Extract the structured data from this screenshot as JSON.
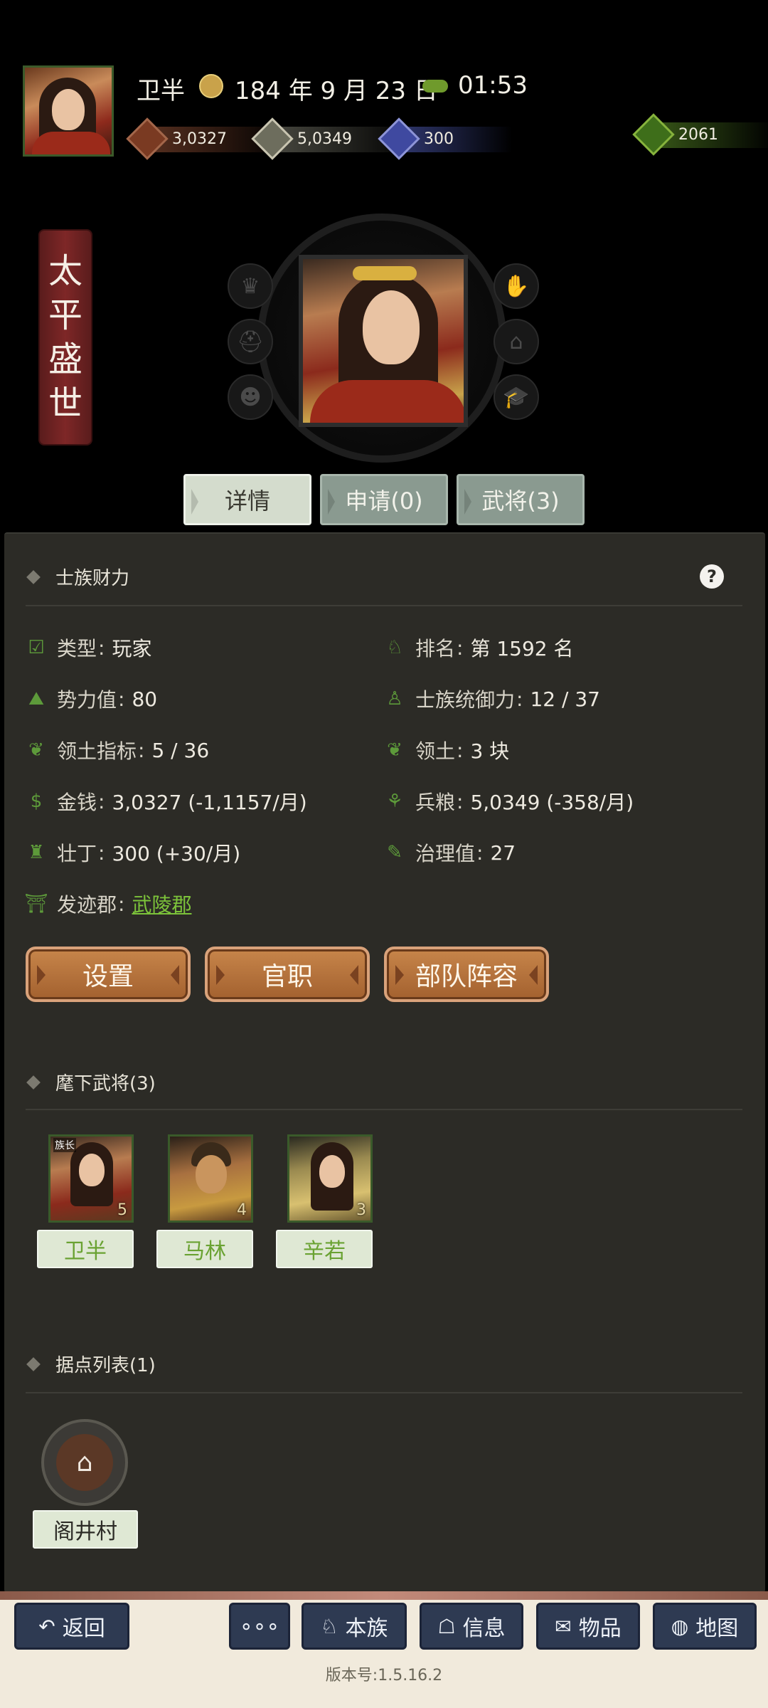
{
  "header": {
    "player_name": "卫半",
    "date": "184 年 9 月 23 日",
    "time": "01:53",
    "resources": {
      "gold": "3,0327",
      "grain": "5,0349",
      "manpower": "300",
      "gourd": "2061"
    }
  },
  "banner": {
    "chars": [
      "太",
      "平",
      "盛",
      "世"
    ]
  },
  "tabs": {
    "details": "详情",
    "apply": "申请(0)",
    "generals": "武将(3)"
  },
  "clan_finance": {
    "title": "士族财力",
    "help_icon": "?",
    "stats": {
      "type": {
        "label": "类型",
        "value": "玩家"
      },
      "rank": {
        "label": "排名",
        "value": "第 1592 名"
      },
      "power": {
        "label": "势力值",
        "value": "80"
      },
      "command": {
        "label": "士族统御力",
        "value": "12 / 37"
      },
      "territory_quota": {
        "label": "领土指标",
        "value": "5 / 36"
      },
      "territory": {
        "label": "领土",
        "value": "3 块"
      },
      "money": {
        "label": "金钱",
        "value": "3,0327 (-1,1157/月)"
      },
      "grain": {
        "label": "兵粮",
        "value": "5,0349 (-358/月)"
      },
      "manpower": {
        "label": "壮丁",
        "value": "300 (+30/月)"
      },
      "governance": {
        "label": "治理值",
        "value": "27"
      },
      "origin": {
        "label": "发迹郡",
        "value": "武陵郡"
      }
    },
    "buttons": {
      "settings": "设置",
      "office": "官职",
      "troops": "部队阵容"
    }
  },
  "generals_section": {
    "title": "麾下武将(3)",
    "leader_tag": "族长",
    "generals": [
      {
        "name": "卫半",
        "level": "5"
      },
      {
        "name": "马林",
        "level": "4"
      },
      {
        "name": "辛若",
        "level": "3"
      }
    ]
  },
  "strongholds_section": {
    "title": "据点列表(1)",
    "items": [
      {
        "name": "阁井村"
      }
    ]
  },
  "bottom_nav": {
    "back": "返回",
    "more": "∘∘∘",
    "clan": "本族",
    "info": "信息",
    "items": "物品",
    "map": "地图"
  },
  "version": "版本号:1.5.16.2",
  "colors": {
    "accent_green": "#7cc33a",
    "panel_bg": "#2c2b26",
    "action_orange": "#c7854a",
    "nav_blue": "#2e3a52"
  }
}
